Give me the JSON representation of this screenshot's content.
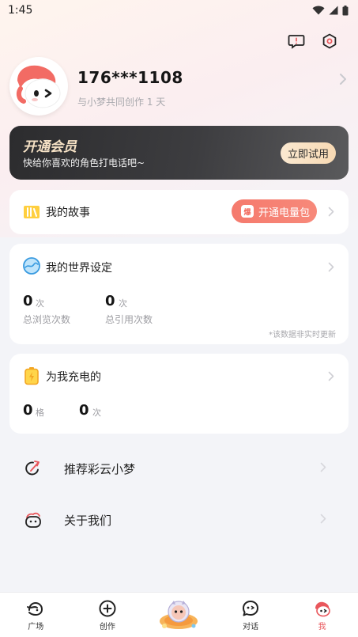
{
  "status_bar": {
    "time": "1:45"
  },
  "profile": {
    "username": "176***1108",
    "subtitle": "与小梦共同创作 1 天"
  },
  "vip": {
    "title": "开通会员",
    "subtitle": "快给你喜欢的角色打电话吧~",
    "button_label": "立即试用"
  },
  "stories": {
    "title": "我的故事",
    "energy_badge": "爆",
    "energy_button_label": "开通电量包"
  },
  "world": {
    "title": "我的世界设定",
    "views_value": "0",
    "views_unit": "次",
    "views_label": "总浏览次数",
    "refs_value": "0",
    "refs_unit": "次",
    "refs_label": "总引用次数",
    "note": "*该数据非实时更新"
  },
  "charge": {
    "title": "为我充电的",
    "grid_value": "0",
    "grid_unit": "格",
    "times_value": "0",
    "times_unit": "次"
  },
  "menu": {
    "recommend_label": "推荐彩云小梦",
    "about_label": "关于我们"
  },
  "nav": {
    "plaza": "广场",
    "create": "创作",
    "chat": "对话",
    "me": "我"
  },
  "colors": {
    "accent": "#e9575c",
    "energy": "#f57a6d",
    "vip_gold": "#f6e2c6"
  }
}
